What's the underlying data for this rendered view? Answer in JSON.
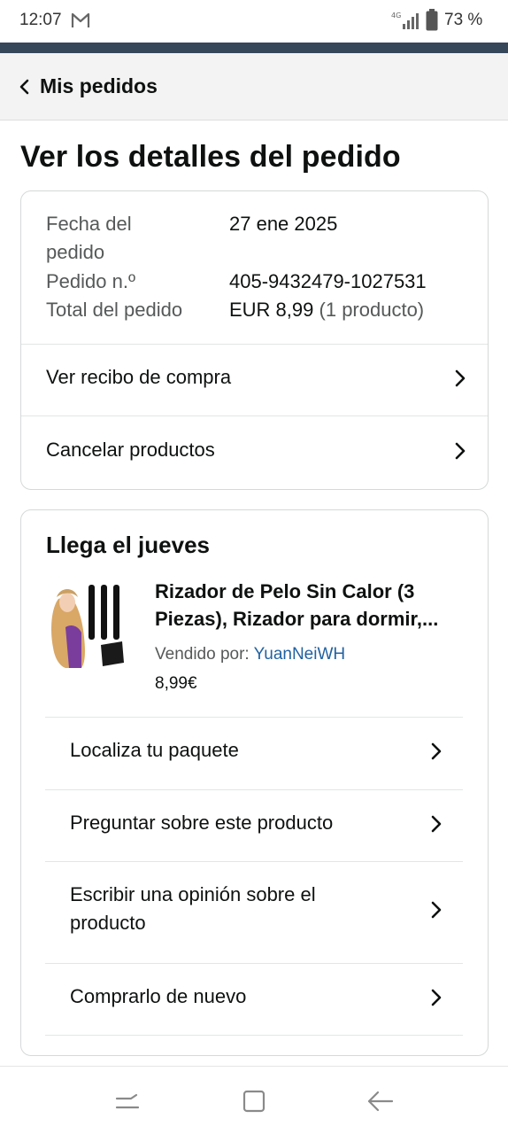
{
  "status_bar": {
    "time": "12:07",
    "network": "4G",
    "battery": "73 %"
  },
  "nav": {
    "back_label": "Mis pedidos"
  },
  "page": {
    "title": "Ver los detalles del pedido"
  },
  "order_summary": {
    "date_label": "Fecha del",
    "date_label_2": "pedido",
    "date_value": "27 ene 2025",
    "number_label": "Pedido n.º",
    "number_value": "405-9432479-1027531",
    "total_label": "Total del pedido",
    "total_value": "EUR 8,99",
    "total_count": "(1 producto)",
    "actions": [
      {
        "label": "Ver recibo de compra"
      },
      {
        "label": "Cancelar productos"
      }
    ]
  },
  "shipment": {
    "arrival": "Llega el jueves",
    "product": {
      "title_line1": "Rizador de Pelo Sin Calor (3",
      "title_line2": "Piezas), Rizador para dormir,...",
      "sold_by_label": "Vendido por: ",
      "seller": "YuanNeiWH",
      "price": "8,99€"
    },
    "actions": [
      {
        "label": "Localiza tu paquete"
      },
      {
        "label": "Preguntar sobre este producto"
      },
      {
        "label": "Escribir una opinión sobre el",
        "label2": "producto"
      },
      {
        "label": "Comprarlo de nuevo"
      }
    ]
  },
  "colors": {
    "header_dark": "#37475a",
    "link": "#2162a1",
    "text": "#0f1111",
    "muted": "#565959"
  }
}
